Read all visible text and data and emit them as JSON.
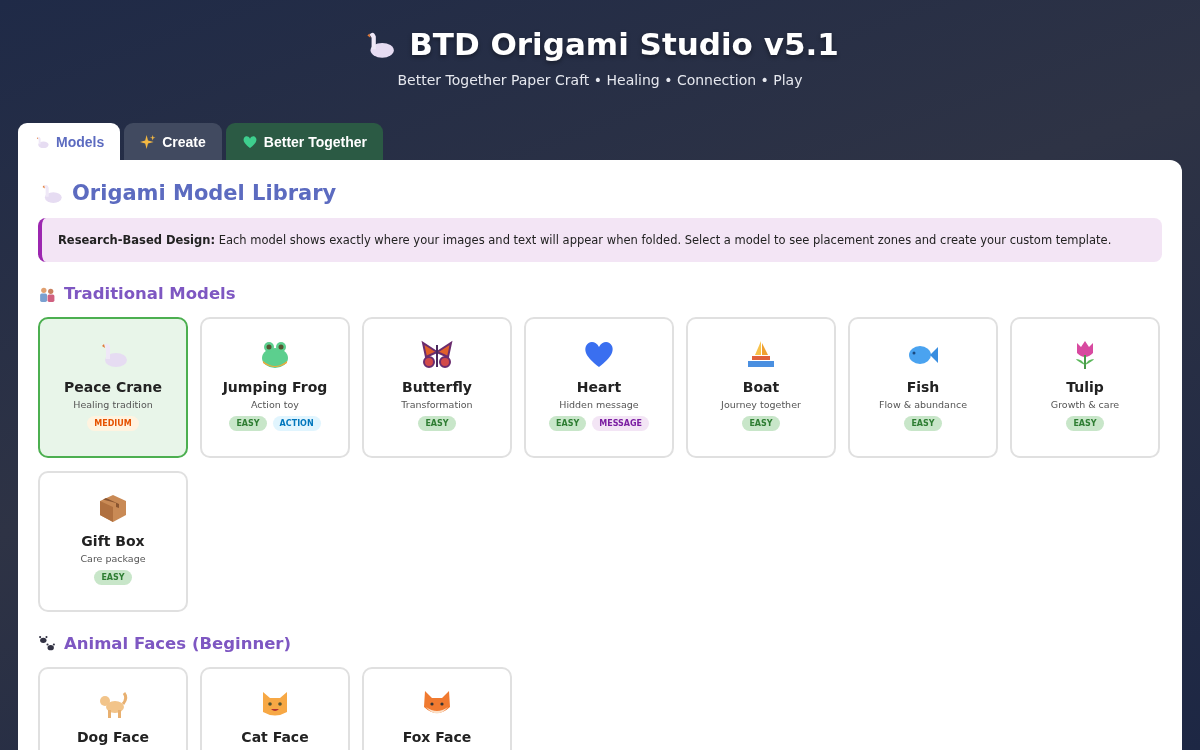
{
  "header": {
    "title": "BTD Origami Studio v5.1",
    "subtitle": "Better Together Paper Craft • Healing • Connection • Play"
  },
  "tabs": [
    {
      "label": "Models",
      "selected": true,
      "kind": "plain"
    },
    {
      "label": "Create",
      "selected": false,
      "kind": "slate"
    },
    {
      "label": "Better Together",
      "selected": false,
      "kind": "green"
    }
  ],
  "library": {
    "title": "Origami Model Library",
    "notice": "**Research-Based Design:** Each model shows exactly where your images and text will appear when folded. Select a model to see placement zones and create your custom template.",
    "sections": [
      {
        "title": "Traditional Models",
        "models": [
          {
            "name": "Peace Crane",
            "description": "Healing tradition",
            "selected": true,
            "tags": [
              {
                "label": "MEDIUM",
                "kind": "medium"
              }
            ]
          },
          {
            "name": "Jumping Frog",
            "description": "Action toy",
            "selected": false,
            "tags": [
              {
                "label": "EASY",
                "kind": "easy"
              },
              {
                "label": "ACTION",
                "kind": "action"
              }
            ]
          },
          {
            "name": "Butterfly",
            "description": "Transformation",
            "selected": false,
            "tags": [
              {
                "label": "EASY",
                "kind": "easy"
              }
            ]
          },
          {
            "name": "Heart",
            "description": "Hidden message",
            "selected": false,
            "tags": [
              {
                "label": "EASY",
                "kind": "easy"
              },
              {
                "label": "MESSAGE",
                "kind": "message"
              }
            ]
          },
          {
            "name": "Boat",
            "description": "Journey together",
            "selected": false,
            "tags": [
              {
                "label": "EASY",
                "kind": "easy"
              }
            ]
          },
          {
            "name": "Fish",
            "description": "Flow & abundance",
            "selected": false,
            "tags": [
              {
                "label": "EASY",
                "kind": "easy"
              }
            ]
          },
          {
            "name": "Tulip",
            "description": "Growth & care",
            "selected": false,
            "tags": [
              {
                "label": "EASY",
                "kind": "easy"
              }
            ]
          },
          {
            "name": "Gift Box",
            "description": "Care package",
            "selected": false,
            "tags": [
              {
                "label": "EASY",
                "kind": "easy"
              }
            ]
          }
        ]
      },
      {
        "title": "Animal Faces (Beginner)",
        "models": [
          {
            "name": "Dog Face",
            "selected": false
          },
          {
            "name": "Cat Face",
            "selected": false
          },
          {
            "name": "Fox Face",
            "selected": false
          }
        ]
      }
    ]
  }
}
